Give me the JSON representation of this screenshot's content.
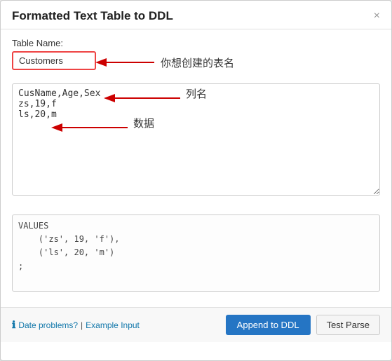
{
  "dialog": {
    "title": "Formatted Text Table to DDL",
    "close_label": "×"
  },
  "form": {
    "table_name_label": "Table Name:",
    "table_name_value": "Customers",
    "table_name_placeholder": "Customers",
    "annotation_table_name": "你想创建的表名",
    "annotation_col_name": "列名",
    "annotation_data": "数据",
    "data_input": "CusName,Age,Sex\nzs,19,f\nls,20,m"
  },
  "output": {
    "content": "VALUES\n    ('zs', 19, 'f'),\n    ('ls', 20, 'm')\n;"
  },
  "footer": {
    "info_text": "Date problems?",
    "example_link": "Example Input",
    "separator": "|",
    "append_btn": "Append to DDL",
    "test_btn": "Test Parse"
  }
}
